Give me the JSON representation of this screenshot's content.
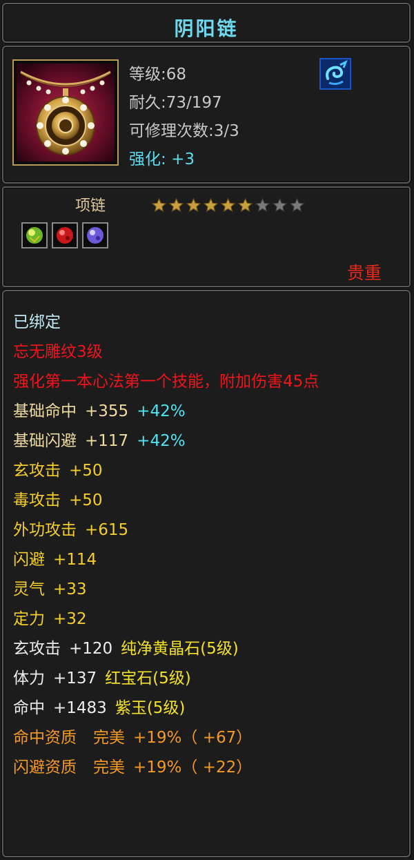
{
  "item": {
    "name": "阴阳链",
    "level_line": "等级:68",
    "durability_line": "耐久:73/197",
    "repair_line": "可修理次数:3/3",
    "enhance_label": "强化:",
    "enhance_value": "+3",
    "type": "项链",
    "stars_filled": 6,
    "stars_total": 9,
    "rarity": "贵重",
    "gem_slots": [
      "green-gem-icon",
      "red-gem-icon",
      "purple-gem-icon"
    ]
  },
  "colors": {
    "title": "#6fd8ec",
    "bound": "#bfe8f3",
    "red": "#f0141c",
    "base_stat": "#f0dca0",
    "percent": "#50e4f2",
    "attack": "#f4ce2a",
    "gem": "#f4e22a",
    "aptitude": "#f49a24"
  },
  "stats": {
    "bound": "已绑定",
    "engrave": "忘无雕纹3级",
    "engrave_effect": "强化第一本心法第一个技能，附加伤害45点",
    "hit_label": "基础命中",
    "hit_value": "+355",
    "hit_pct": "+42%",
    "dodge_label": "基础闪避",
    "dodge_value": "+117",
    "dodge_pct": "+42%",
    "l1_label": "玄攻击",
    "l1_value": "+50",
    "l2_label": "毒攻击",
    "l2_value": "+50",
    "l3_label": "外功攻击",
    "l3_value": "+615",
    "l4_label": "闪避",
    "l4_value": "+114",
    "l5_label": "灵气",
    "l5_value": "+33",
    "l6_label": "定力",
    "l6_value": "+32",
    "g1_label": "玄攻击",
    "g1_value": "+120",
    "g1_gem": "纯净黄晶石(5级)",
    "g2_label": "体力",
    "g2_value": "+137",
    "g2_gem": "红宝石(5级)",
    "g3_label": "命中",
    "g3_value": "+1483",
    "g3_gem": "紫玉(5级)",
    "a1_label": "命中资质",
    "a1_grade": "完美",
    "a1_value": "+19%（ +67）",
    "a2_label": "闪避资质",
    "a2_grade": "完美",
    "a2_value": "+19%（ +22）"
  }
}
